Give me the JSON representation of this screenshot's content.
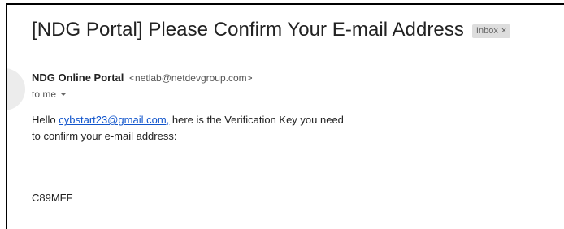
{
  "email": {
    "subject": "[NDG Portal] Please Confirm Your E-mail Address",
    "label": {
      "text": "Inbox",
      "close": "×"
    },
    "sender": {
      "name": "NDG Online Portal",
      "address": "<netlab@netdevgroup.com>"
    },
    "recipient": "to me",
    "body": {
      "greeting": "Hello",
      "link_text": "cybstart23@gmail.com,",
      "line1_rest": " here is the Verification Key you need",
      "line2": "to confirm your e-mail address:",
      "verification_key": "C89MFF"
    }
  }
}
